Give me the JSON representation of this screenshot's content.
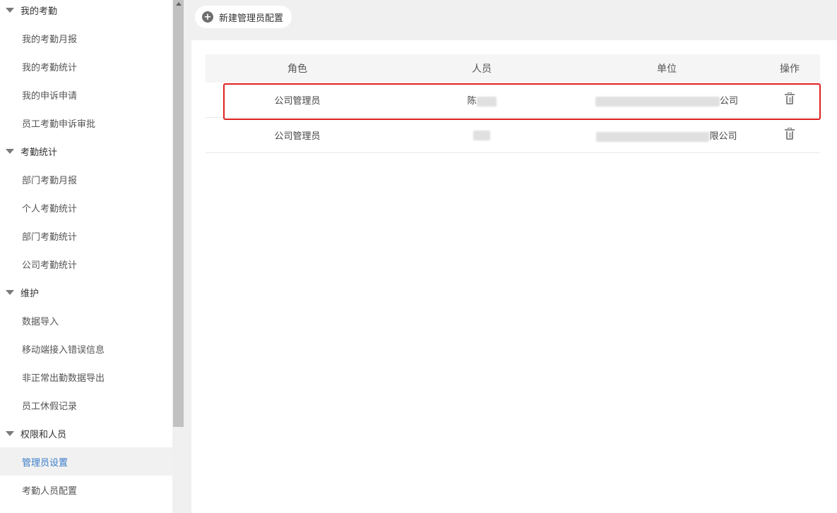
{
  "sidebar": {
    "groups": [
      {
        "title": "我的考勤",
        "items": [
          "我的考勤月报",
          "我的考勤统计",
          "我的申诉申请",
          "员工考勤申诉审批"
        ]
      },
      {
        "title": "考勤统计",
        "items": [
          "部门考勤月报",
          "个人考勤统计",
          "部门考勤统计",
          "公司考勤统计"
        ]
      },
      {
        "title": "维护",
        "items": [
          "数据导入",
          "移动端接入错误信息",
          "非正常出勤数据导出",
          "员工休假记录"
        ]
      },
      {
        "title": "权限和人员",
        "items": [
          "管理员设置",
          "考勤人员配置"
        ]
      }
    ],
    "active_item": "管理员设置"
  },
  "toolbar": {
    "new_label": "新建管理员配置"
  },
  "table": {
    "columns": [
      "角色",
      "人员",
      "单位",
      "操作"
    ],
    "rows": [
      {
        "role": "公司管理员",
        "person": "陈",
        "unit_suffix": "公司"
      },
      {
        "role": "公司管理员",
        "person": "",
        "unit_suffix": "限公司"
      }
    ]
  },
  "icons": {
    "delete": "trash-icon",
    "add": "plus-circle-icon",
    "collapse": "triangle-down-icon"
  },
  "colors": {
    "active_text": "#3a7dc9",
    "highlight_border": "#e02020"
  }
}
